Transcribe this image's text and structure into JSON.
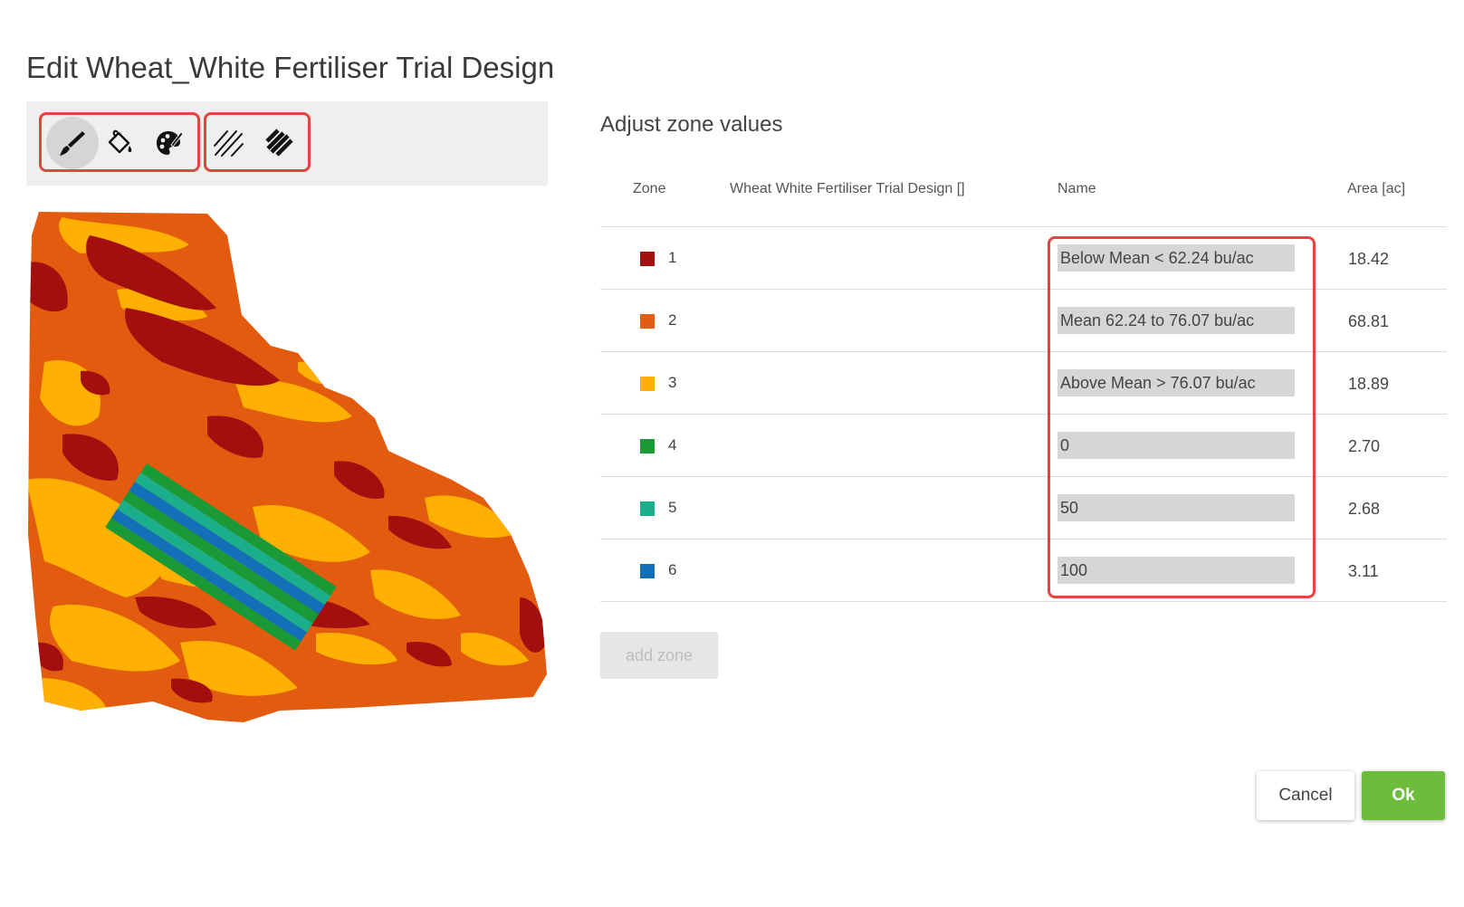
{
  "dialog": {
    "title": "Edit Wheat_White Fertiliser Trial Design"
  },
  "toolbar": {
    "draw_tools": [
      {
        "icon": "brush-icon",
        "active": true
      },
      {
        "icon": "paint-bucket-icon",
        "active": false
      },
      {
        "icon": "palette-icon",
        "active": false
      }
    ],
    "pattern_tools": [
      {
        "icon": "thin-stripes-icon"
      },
      {
        "icon": "thick-stripes-icon"
      }
    ]
  },
  "zones_panel": {
    "title": "Adjust zone values",
    "columns": {
      "zone": "Zone",
      "design": "Wheat White Fertiliser Trial Design []",
      "name": "Name",
      "area": "Area [ac]"
    },
    "rows": [
      {
        "zone": "1",
        "color": "#a30f0f",
        "name": "Below Mean < 62.24 bu/ac",
        "area": "18.42"
      },
      {
        "zone": "2",
        "color": "#e25b0e",
        "name": "Mean 62.24 to 76.07 bu/ac",
        "area": "68.81"
      },
      {
        "zone": "3",
        "color": "#ffb000",
        "name": "Above Mean > 76.07 bu/ac",
        "area": "18.89"
      },
      {
        "zone": "4",
        "color": "#1a9a36",
        "name": "0",
        "area": "2.70"
      },
      {
        "zone": "5",
        "color": "#1aae8b",
        "name": "50",
        "area": "2.68"
      },
      {
        "zone": "6",
        "color": "#1270b8",
        "name": "100",
        "area": "3.11"
      }
    ],
    "add_zone_label": "add zone"
  },
  "actions": {
    "cancel_label": "Cancel",
    "ok_label": "Ok"
  },
  "colors": {
    "highlight": "#e0473f",
    "ok_button": "#6cbd3c"
  }
}
